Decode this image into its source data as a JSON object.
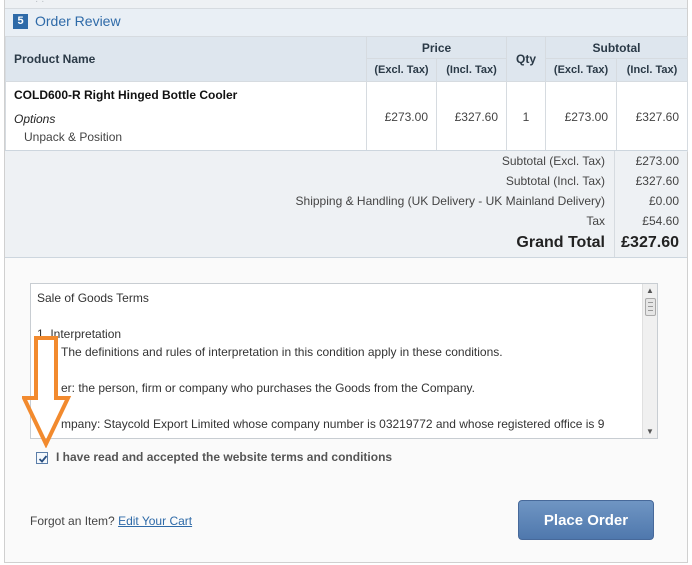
{
  "step": {
    "number": "5",
    "title": "Order Review"
  },
  "table": {
    "headers": {
      "product": "Product Name",
      "price": "Price",
      "qty": "Qty",
      "subtotal": "Subtotal",
      "excl_tax": "(Excl. Tax)",
      "incl_tax": "(Incl. Tax)"
    },
    "rows": [
      {
        "name": "COLD600-R Right Hinged Bottle Cooler",
        "options_label": "Options",
        "option_value": "Unpack & Position",
        "price_excl": "£273.00",
        "price_incl": "£327.60",
        "qty": "1",
        "subtotal_excl": "£273.00",
        "subtotal_incl": "£327.60"
      }
    ]
  },
  "totals": {
    "subtotal_excl_label": "Subtotal (Excl. Tax)",
    "subtotal_excl_value": "£273.00",
    "subtotal_incl_label": "Subtotal (Incl. Tax)",
    "subtotal_incl_value": "£327.60",
    "shipping_label": "Shipping & Handling (UK Delivery - UK Mainland Delivery)",
    "shipping_value": "£0.00",
    "tax_label": "Tax",
    "tax_value": "£54.60",
    "grand_label": "Grand Total",
    "grand_value": "£327.60"
  },
  "terms": {
    "lines": [
      "Sale of Goods Terms",
      "1. Interpretation",
      "The definitions and rules of interpretation in this condition apply in these conditions.",
      "er: the person, firm or company who purchases the Goods from the Company.",
      "mpany: Staycold Export Limited whose company number is 03219772 and whose registered office is 9"
    ],
    "agree_label": "I have read and accepted the website terms and conditions",
    "agree_checked": true
  },
  "footer": {
    "forgot_text": "Forgot an Item?",
    "edit_cart_link": "Edit Your Cart",
    "place_order_label": "Place Order"
  },
  "colors": {
    "accent": "#2e6aa8",
    "annotation_arrow": "#f28a2e"
  }
}
